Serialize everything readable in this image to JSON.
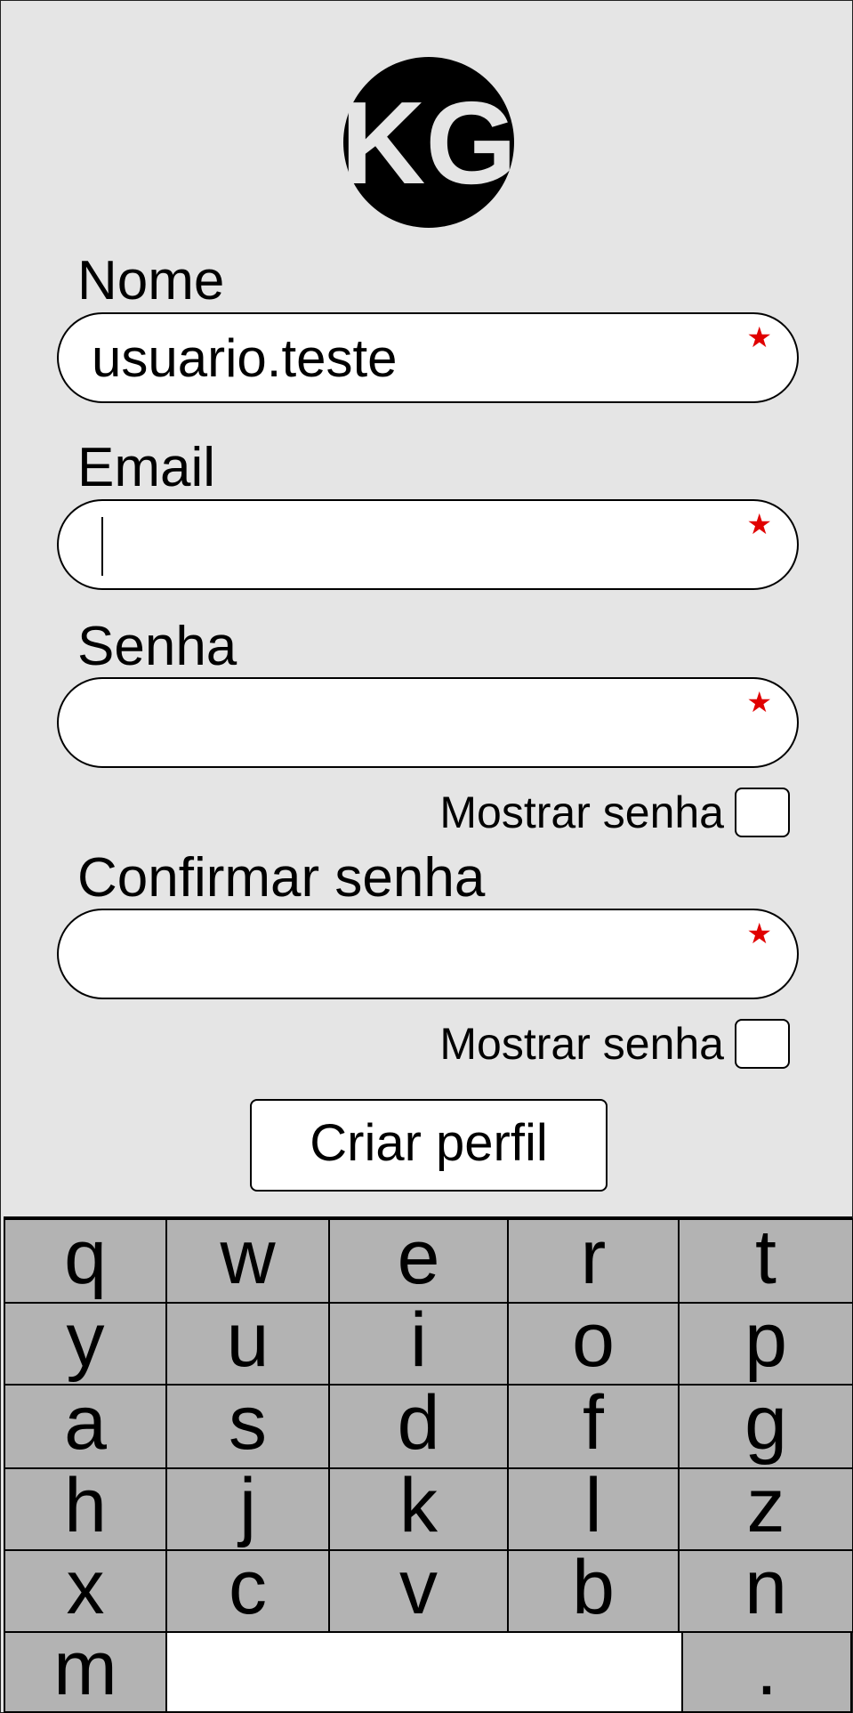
{
  "logo": {
    "text": "KG"
  },
  "form": {
    "nome": {
      "label": "Nome",
      "value": "usuario.teste",
      "required_mark": "★"
    },
    "email": {
      "label": "Email",
      "value": "",
      "required_mark": "★"
    },
    "senha": {
      "label": "Senha",
      "value": "",
      "required_mark": "★",
      "show_label": "Mostrar senha"
    },
    "confirmar": {
      "label": "Confirmar senha",
      "value": "",
      "required_mark": "★",
      "show_label": "Mostrar senha"
    },
    "submit_label": "Criar perfil"
  },
  "keyboard": {
    "rows": [
      [
        "q",
        "w",
        "e",
        "r",
        "t"
      ],
      [
        "y",
        "u",
        "i",
        "o",
        "p"
      ],
      [
        "a",
        "s",
        "d",
        "f",
        "g"
      ],
      [
        "h",
        "j",
        "k",
        "l",
        "z"
      ],
      [
        "x",
        "c",
        "v",
        "b",
        "n"
      ]
    ],
    "bottom_left": "m",
    "bottom_right": "."
  },
  "colors": {
    "background": "#e5e5e5",
    "key_fill": "#b3b3b3",
    "required_star": "#e00000"
  }
}
